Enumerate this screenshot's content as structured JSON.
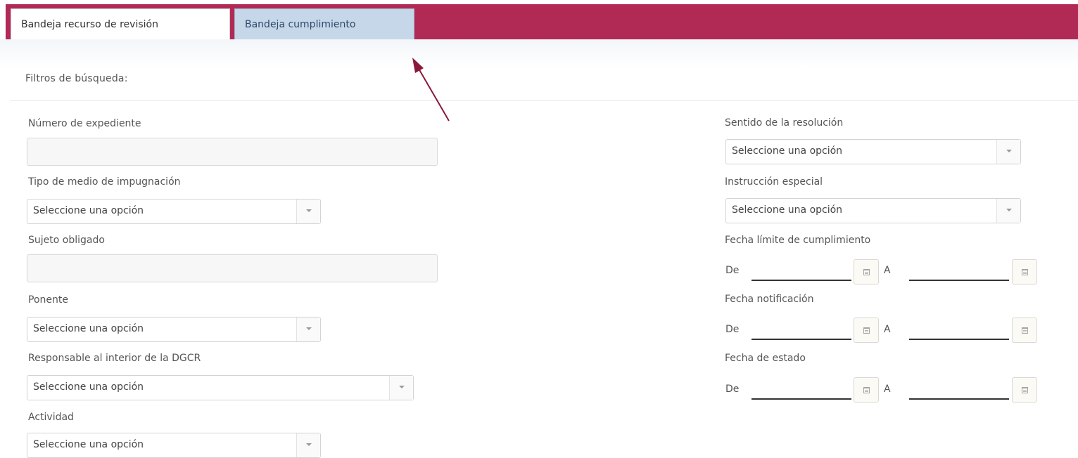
{
  "tabs": [
    {
      "label": "Bandeja recurso de revisión",
      "active": true
    },
    {
      "label": "Bandeja cumplimiento",
      "active": false
    }
  ],
  "colors": {
    "tab_band": "#b02a55",
    "tab_selected_alt": "#c5d7e8",
    "annotation_arrow": "#8a1a3a"
  },
  "filters": {
    "title": "Filtros de búsqueda:",
    "numero_expediente": {
      "label": "Número de expediente",
      "value": ""
    },
    "tipo_medio": {
      "label": "Tipo de medio de impugnación",
      "value": "Seleccione una opción"
    },
    "sujeto_obligado": {
      "label": "Sujeto obligado",
      "value": ""
    },
    "ponente": {
      "label": "Ponente",
      "value": "Seleccione una opción"
    },
    "responsable": {
      "label": "Responsable al interior de la DGCR",
      "value": "Seleccione una opción"
    },
    "actividad": {
      "label": "Actividad",
      "value": "Seleccione una opción"
    },
    "sentido_resolucion": {
      "label": "Sentido de la resolución",
      "value": "Seleccione una opción"
    },
    "instruccion_especial": {
      "label": "Instrucción especial",
      "value": "Seleccione una opción"
    },
    "fecha_limite": {
      "label": "Fecha límite de cumplimiento",
      "from_prefix": "De",
      "to_prefix": "A",
      "from_value": "",
      "to_value": ""
    },
    "fecha_notificacion": {
      "label": "Fecha notificación",
      "from_prefix": "De",
      "to_prefix": "A",
      "from_value": "",
      "to_value": ""
    },
    "fecha_estado": {
      "label": "Fecha de estado",
      "from_prefix": "De",
      "to_prefix": "A",
      "from_value": "",
      "to_value": ""
    }
  },
  "icons": {
    "dropdown": "chevron-down-icon",
    "calendar": "calendar-icon"
  }
}
